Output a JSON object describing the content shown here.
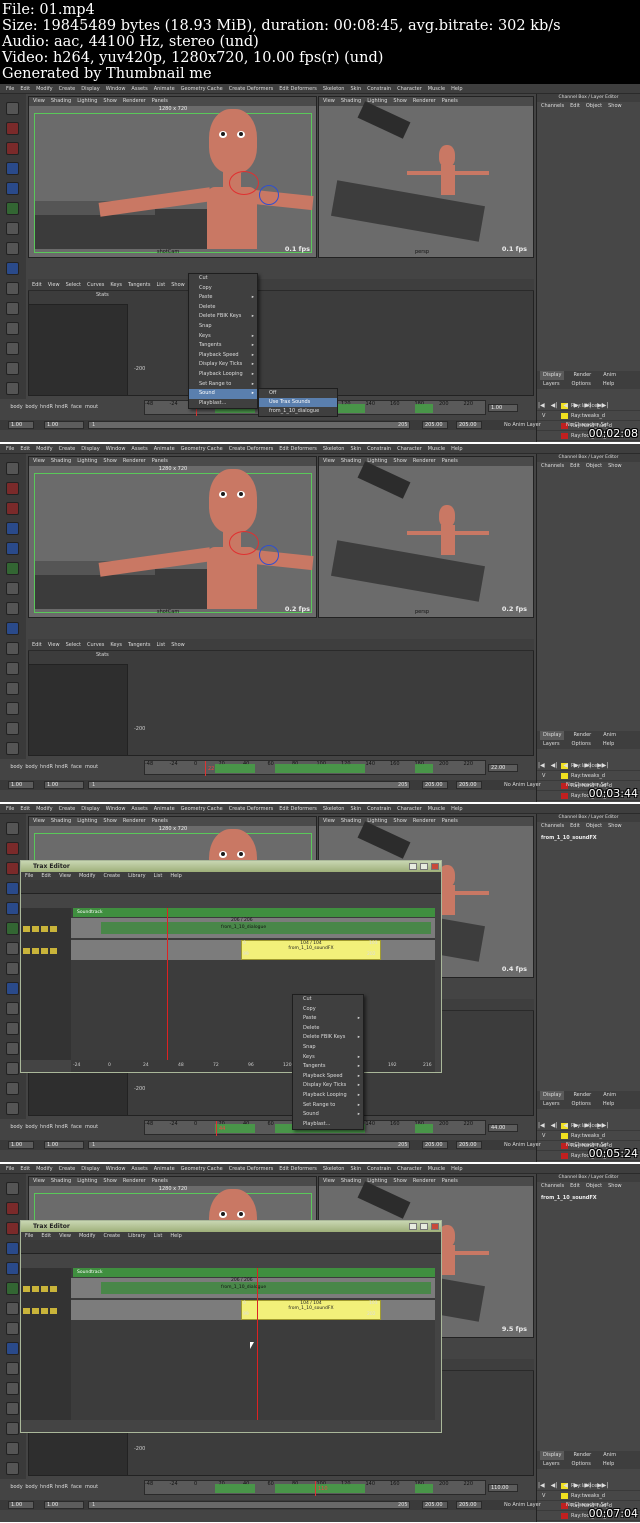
{
  "header": {
    "lines": [
      "File: 01.mp4",
      "Size: 19845489 bytes (18.93 MiB), duration: 00:08:45, avg.bitrate: 302 kb/s",
      "Audio: aac, 44100 Hz, stereo (und)",
      "Video: h264, yuv420p, 1280x720, 10.00 fps(r) (und)",
      "Generated by Thumbnail me"
    ]
  },
  "app": {
    "main_menu": [
      "File",
      "Edit",
      "Modify",
      "Create",
      "Display",
      "Window",
      "Assets",
      "Animate",
      "Geometry Cache",
      "Create Deformers",
      "Edit Deformers",
      "Skeleton",
      "Skin",
      "Constrain",
      "Character",
      "Muscle",
      "Help"
    ],
    "viewport_menu": [
      "View",
      "Shading",
      "Lighting",
      "Show",
      "Renderer",
      "Panels"
    ],
    "resolution_gate": "1280 x 720",
    "left_camera": "shotCam",
    "right_camera": "persp",
    "channel_box_title": "Channel Box / Layer Editor",
    "channel_box_menu": [
      "Channels",
      "Edit",
      "Object",
      "Show"
    ],
    "layer_tabs": [
      "Display",
      "Render",
      "Anim"
    ],
    "layer_menu": [
      "Layers",
      "Options",
      "Help"
    ],
    "layers": [
      {
        "vis": "",
        "name": "Ray:lattice_d",
        "color": "#f0e020"
      },
      {
        "vis": "V",
        "name": "Ray:tweaks_d",
        "color": "#f0e020"
      },
      {
        "vis": "",
        "name": "Ray:hand_hud_d",
        "color": "#c02020"
      },
      {
        "vis": "",
        "name": "Ray:foot_hud_d",
        "color": "#c02020"
      },
      {
        "vis": "V",
        "name": "Ray:JS_d",
        "color": "#c02020"
      },
      {
        "vis": "V",
        "name": "Ray:CTLs_d",
        "color": "#c02020"
      }
    ],
    "graph_menu": [
      "Edit",
      "View",
      "Select",
      "Curves",
      "Keys",
      "Tangents",
      "List",
      "Show"
    ],
    "stats_label": "Stats",
    "pose_labels": [
      "body",
      "body",
      "hndR",
      "hndR",
      "face",
      "mout"
    ],
    "timeline_ticks": [
      "-48",
      "-24",
      "0",
      "20",
      "40",
      "60",
      "80",
      "100",
      "120",
      "140",
      "160",
      "180",
      "200",
      "220"
    ],
    "range": {
      "start": "1.00",
      "start2": "1.00",
      "inner_start": "1",
      "end": "205",
      "end2": "205.00",
      "end3": "205.00"
    },
    "anim_layer": "No Anim Layer",
    "character_set": "No Character Set",
    "graph_y_label": "-200"
  },
  "frames": [
    {
      "timestamp": "00:02:08",
      "fps_left": "0.1 fps",
      "fps_right": "0.1 fps",
      "current_frame": "1.00",
      "context_menu": [
        "Cut",
        "Copy",
        "Paste",
        "Delete",
        "Delete FBIK Keys",
        "Snap",
        "Keys",
        "Tangents",
        "Playback Speed",
        "Display Key Ticks",
        "Playback Looping",
        "Set Range to",
        "Sound",
        "Playblast..."
      ],
      "context_arrows": [
        false,
        false,
        true,
        false,
        true,
        false,
        true,
        true,
        true,
        true,
        true,
        true,
        true,
        false
      ],
      "sound_submenu": [
        "Off",
        "Use Trax Sounds",
        "from_1_10_dialogue"
      ]
    },
    {
      "timestamp": "00:03:44",
      "fps_left": "0.2 fps",
      "fps_right": "0.2 fps",
      "current_frame": "22.00",
      "cursor_label": "22"
    },
    {
      "timestamp": "00:05:24",
      "fps_right": "0.4 fps",
      "current_frame": "44.00",
      "cursor_label": "44",
      "object_name": "from_1_10_soundFX",
      "trax": {
        "title": "Trax Editor",
        "menu": [
          "File",
          "Edit",
          "View",
          "Modify",
          "Create",
          "Library",
          "List",
          "Help"
        ],
        "soundtrack_label": "Soundtrack",
        "clip1_label": "from_1_10_dialogue",
        "clip1_range": "206 / 206",
        "clip2_label": "from_1_10_soundFX",
        "clip2_range": "104 / 104",
        "clip2_start": "0",
        "clip2_start2": "99",
        "clip2_end": "103",
        "clip2_end2": "202",
        "ruler": [
          "-24",
          "0",
          "24",
          "48",
          "72",
          "96",
          "120",
          "144",
          "168",
          "192",
          "216"
        ]
      },
      "context_menu": [
        "Cut",
        "Copy",
        "Paste",
        "Delete",
        "Delete FBIK Keys",
        "Snap",
        "Keys",
        "Tangents",
        "Playback Speed",
        "Display Key Ticks",
        "Playback Looping",
        "Set Range to",
        "Sound",
        "Playblast..."
      ],
      "context_arrows": [
        false,
        false,
        true,
        false,
        true,
        false,
        true,
        true,
        true,
        true,
        true,
        true,
        true,
        false
      ]
    },
    {
      "timestamp": "00:07:04",
      "fps_right": "9.5 fps",
      "current_frame": "110.00",
      "cursor_label": "110",
      "object_name": "from_1_10_soundFX",
      "trax": {
        "title": "Trax Editor",
        "menu": [
          "File",
          "Edit",
          "View",
          "Modify",
          "Create",
          "Library",
          "List",
          "Help"
        ],
        "soundtrack_label": "Soundtrack",
        "clip1_label": "from_1_10_dialogue",
        "clip1_range": "206 / 206",
        "clip2_label": "from_1_10_soundFX",
        "clip2_range": "104 / 104",
        "clip2_start": "0",
        "clip2_start2": "99",
        "clip2_end": "103",
        "clip2_end2": "202"
      }
    }
  ]
}
